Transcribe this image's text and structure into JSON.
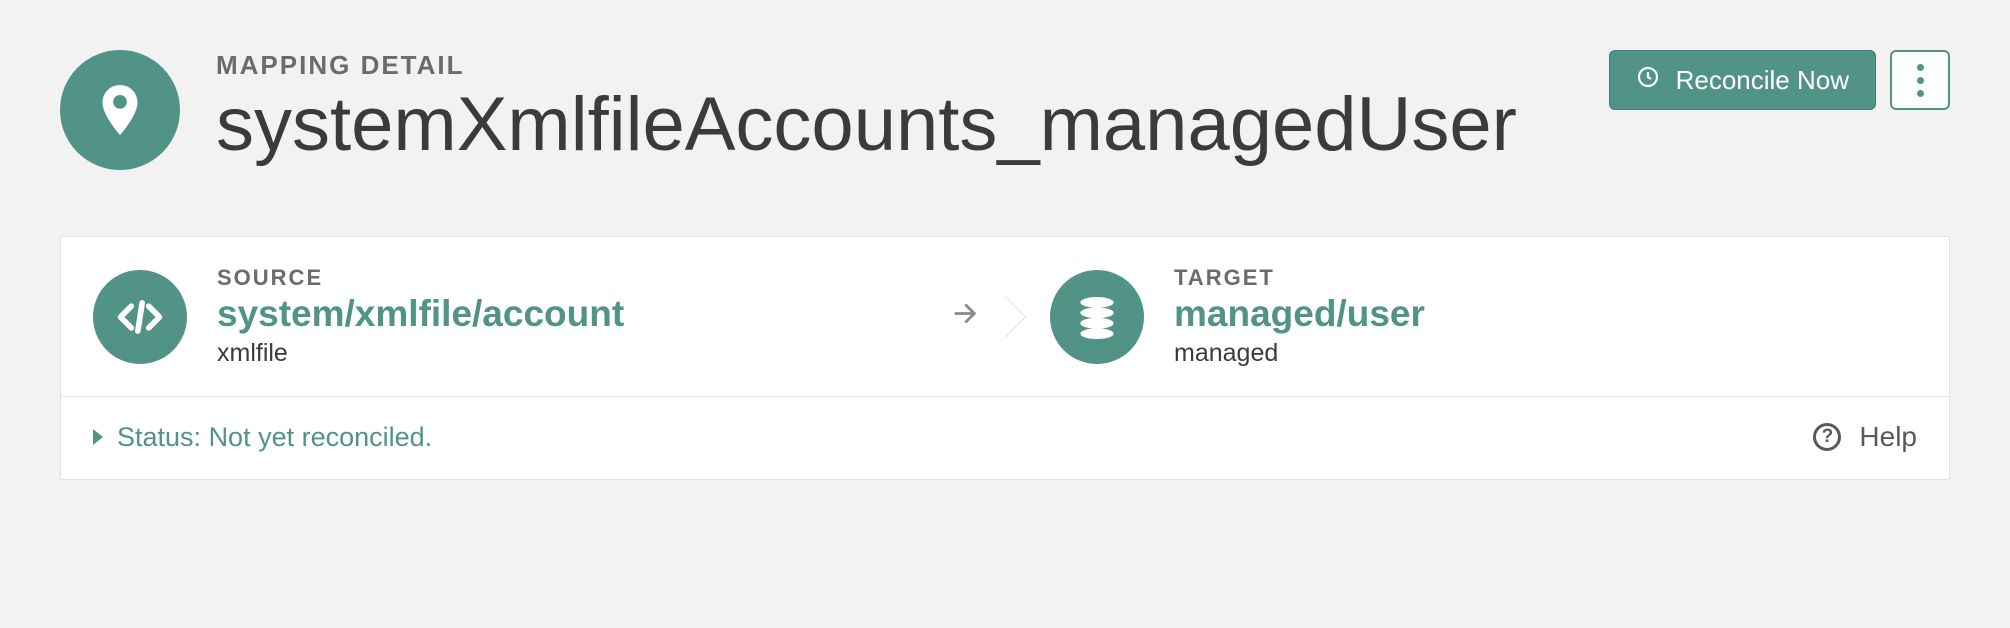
{
  "header": {
    "overline": "MAPPING DETAIL",
    "title": "systemXmlfileAccounts_managedUser",
    "reconcile_label": "Reconcile Now"
  },
  "mapping": {
    "source": {
      "overline": "SOURCE",
      "path": "system/xmlfile/account",
      "type": "xmlfile"
    },
    "target": {
      "overline": "TARGET",
      "path": "managed/user",
      "type": "managed"
    }
  },
  "footer": {
    "status_prefix": "Status:",
    "status_value": "Not yet reconciled.",
    "help_label": "Help"
  },
  "colors": {
    "accent": "#519387"
  }
}
